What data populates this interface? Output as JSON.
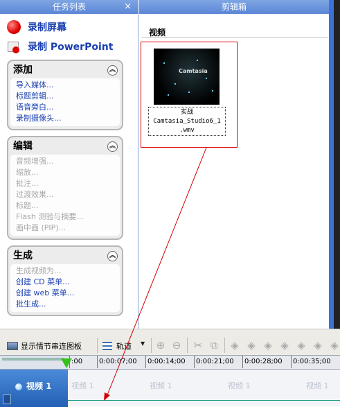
{
  "task_pane": {
    "title": "任务列表",
    "close_glyph": "×",
    "record_screen": "录制屏幕",
    "record_ppt": "录制 PowerPoint",
    "groups": {
      "add": {
        "title": "添加",
        "items": [
          "导入媒体...",
          "标题剪辑...",
          "语音旁白...",
          "录制摄像头..."
        ]
      },
      "edit": {
        "title": "编辑",
        "items": [
          "音频增强...",
          "缩放...",
          "批注...",
          "过渡效果...",
          "标题...",
          "Flash 测验与摘要...",
          "画中画 (PIP)..."
        ]
      },
      "produce": {
        "title": "生成",
        "items": [
          "生成视频为...",
          "创建 CD 菜单...",
          "创建 web 菜单...",
          "批生成..."
        ]
      }
    }
  },
  "clip_bin": {
    "title": "剪辑箱",
    "section": "视频",
    "clip": {
      "caption_line1": "实战",
      "caption_line2": "Camtasia_Studio6_1",
      "caption_line3": ".wmv",
      "thumb_text": "Camtasia"
    }
  },
  "timeline": {
    "toolbar": {
      "storyboard_label": "显示情节串连图板",
      "tracks_label": "轨道",
      "dropdown_glyph": "▼"
    },
    "ruler": {
      "ticks": [
        ":00",
        "0:00:07;00",
        "0:00:14;00",
        "0:00:21;00",
        "0:00:28;00",
        "0:00:35;00"
      ]
    },
    "track": {
      "label": "视频 1",
      "clip_labels": [
        "视频 1",
        "视频 1",
        "视频 1",
        "视频 1"
      ]
    }
  },
  "colors": {
    "header_blue": "#5b86d6",
    "link_blue": "#1a3fb0",
    "highlight_red": "#d00000",
    "playhead_green": "#34c21a",
    "track_label_blue": "#235fb3"
  }
}
